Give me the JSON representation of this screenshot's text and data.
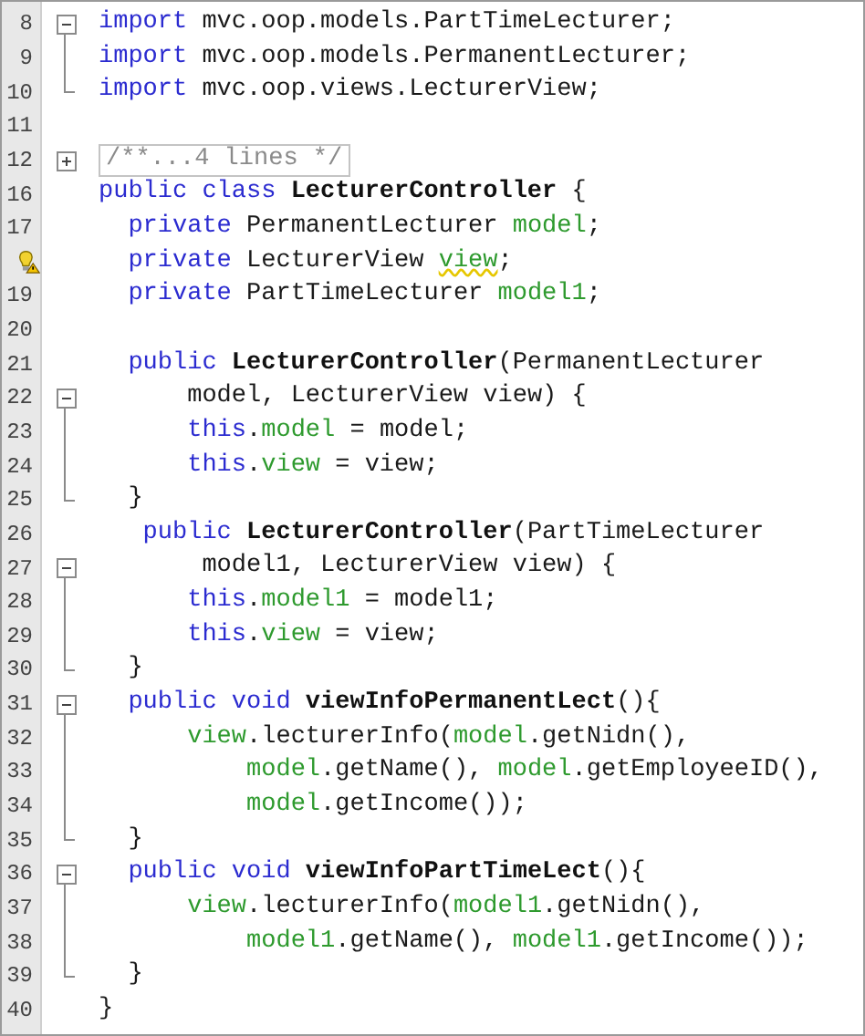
{
  "lines": [
    {
      "number": "8",
      "warning": false,
      "fold": {
        "kind": "start"
      },
      "tokens": [
        {
          "kind": "keyword",
          "text": "import"
        },
        {
          "kind": "plain",
          "text": " mvc.oop.models.PartTimeLecturer;"
        }
      ]
    },
    {
      "number": "9",
      "warning": false,
      "fold": {
        "kind": "line"
      },
      "tokens": [
        {
          "kind": "keyword",
          "text": "import"
        },
        {
          "kind": "plain",
          "text": " mvc.oop.models.PermanentLecturer;"
        }
      ]
    },
    {
      "number": "10",
      "warning": false,
      "fold": {
        "kind": "end"
      },
      "tokens": [
        {
          "kind": "keyword",
          "text": "import"
        },
        {
          "kind": "plain",
          "text": " mvc.oop.views.LecturerView;"
        }
      ]
    },
    {
      "number": "11",
      "warning": false
    },
    {
      "number": "12",
      "warning": false,
      "fold": {
        "kind": "collapsed"
      },
      "tokens": [
        {
          "kind": "folded",
          "text": "/**...4 lines */"
        }
      ]
    },
    {
      "number": "16",
      "warning": false,
      "tokens": [
        {
          "kind": "keyword",
          "text": "public class"
        },
        {
          "kind": "name",
          "text": "LecturerController"
        },
        {
          "kind": "plain",
          "text": " {"
        }
      ]
    },
    {
      "number": "17",
      "warning": false,
      "tokens": [
        {
          "kind": "keyword",
          "text": "  private"
        },
        {
          "kind": "plain",
          "text": " PermanentLecturer "
        },
        {
          "kind": "field",
          "text": "model"
        },
        {
          "kind": "plain",
          "text": ";"
        }
      ]
    },
    {
      "warning": true,
      "tokens": [
        {
          "kind": "keyword",
          "text": "  private"
        },
        {
          "kind": "plain",
          "text": " LecturerView "
        },
        {
          "kind": "field",
          "text": "view"
        },
        {
          "kind": "plain",
          "text": ";"
        }
      ]
    },
    {
      "number": "19",
      "warning": false,
      "tokens": [
        {
          "kind": "keyword",
          "text": "  private"
        },
        {
          "kind": "plain",
          "text": " PartTimeLecturer "
        },
        {
          "kind": "field",
          "text": "model1"
        },
        {
          "kind": "plain",
          "text": ";"
        }
      ]
    },
    {
      "number": "20",
      "warning": false
    },
    {
      "number": "21",
      "warning": false,
      "tokens": [
        {
          "kind": "keyword",
          "text": "  public"
        },
        {
          "kind": "name",
          "text": "LecturerController"
        },
        {
          "kind": "plain",
          "text": "(PermanentLecturer"
        }
      ]
    },
    {
      "number": "22",
      "warning": false,
      "fold": {
        "kind": "start"
      },
      "tokens": [
        {
          "kind": "plain",
          "text": "      model, LecturerView view) {"
        }
      ]
    },
    {
      "number": "23",
      "warning": false,
      "fold": {
        "kind": "line"
      },
      "tokens": [
        {
          "kind": "keyword",
          "text": "      this"
        },
        {
          "kind": "plain",
          "text": "."
        },
        {
          "kind": "field",
          "text": "model"
        },
        {
          "kind": "plain",
          "text": " = model;"
        }
      ]
    },
    {
      "number": "24",
      "warning": false,
      "fold": {
        "kind": "line"
      },
      "tokens": [
        {
          "kind": "keyword",
          "text": "      this"
        },
        {
          "kind": "plain",
          "text": "."
        },
        {
          "kind": "field",
          "text": "view"
        },
        {
          "kind": "plain",
          "text": " = view;"
        }
      ]
    },
    {
      "number": "25",
      "warning": false,
      "fold": {
        "kind": "end"
      },
      "tokens": [
        {
          "kind": "plain",
          "text": "  }"
        }
      ]
    },
    {
      "number": "26",
      "warning": false,
      "tokens": [
        {
          "kind": "keyword",
          "text": "   public"
        },
        {
          "kind": "name",
          "text": "LecturerController"
        },
        {
          "kind": "plain",
          "text": "(PartTimeLecturer"
        }
      ]
    },
    {
      "number": "27",
      "warning": false,
      "fold": {
        "kind": "start"
      },
      "tokens": [
        {
          "kind": "plain",
          "text": "       model1, LecturerView view) {"
        }
      ]
    },
    {
      "number": "28",
      "warning": false,
      "fold": {
        "kind": "line"
      },
      "tokens": [
        {
          "kind": "keyword",
          "text": "      this"
        },
        {
          "kind": "plain",
          "text": "."
        },
        {
          "kind": "field",
          "text": "model1"
        },
        {
          "kind": "plain",
          "text": " = model1;"
        }
      ]
    },
    {
      "number": "29",
      "warning": false,
      "fold": {
        "kind": "line"
      },
      "tokens": [
        {
          "kind": "keyword",
          "text": "      this"
        },
        {
          "kind": "plain",
          "text": "."
        },
        {
          "kind": "field",
          "text": "view"
        },
        {
          "kind": "plain",
          "text": " = view;"
        }
      ]
    },
    {
      "number": "30",
      "warning": false,
      "fold": {
        "kind": "end"
      },
      "tokens": [
        {
          "kind": "plain",
          "text": "  }"
        }
      ]
    },
    {
      "number": "31",
      "warning": false,
      "fold": {
        "kind": "start"
      },
      "tokens": [
        {
          "kind": "keyword",
          "text": "  public void"
        },
        {
          "kind": "name",
          "text": "viewInfoPermanentLect"
        },
        {
          "kind": "plain",
          "text": "(){"
        }
      ]
    },
    {
      "number": "32",
      "warning": false,
      "fold": {
        "kind": "line"
      },
      "tokens": [
        {
          "kind": "field",
          "text": "      view"
        },
        {
          "kind": "plain",
          "text": ".lecturerInfo("
        },
        {
          "kind": "field",
          "text": "model"
        },
        {
          "kind": "plain",
          "text": ".getNidn(),"
        }
      ]
    },
    {
      "number": "33",
      "warning": false,
      "fold": {
        "kind": "line"
      },
      "tokens": [
        {
          "kind": "field",
          "text": "          model"
        },
        {
          "kind": "plain",
          "text": ".getName(), "
        },
        {
          "kind": "field",
          "text": "model"
        },
        {
          "kind": "plain",
          "text": ".getEmployeeID(),"
        }
      ]
    },
    {
      "number": "34",
      "warning": false,
      "fold": {
        "kind": "line"
      },
      "tokens": [
        {
          "kind": "field",
          "text": "          model"
        },
        {
          "kind": "plain",
          "text": ".getIncome());"
        }
      ]
    },
    {
      "number": "35",
      "warning": false,
      "fold": {
        "kind": "end"
      },
      "tokens": [
        {
          "kind": "plain",
          "text": "  }"
        }
      ]
    },
    {
      "number": "36",
      "warning": false,
      "fold": {
        "kind": "start"
      },
      "tokens": [
        {
          "kind": "keyword",
          "text": "  public void"
        },
        {
          "kind": "name",
          "text": "viewInfoPartTimeLect"
        },
        {
          "kind": "plain",
          "text": "(){"
        }
      ]
    },
    {
      "number": "37",
      "warning": false,
      "fold": {
        "kind": "line"
      },
      "tokens": [
        {
          "kind": "field",
          "text": "      view"
        },
        {
          "kind": "plain",
          "text": ".lecturerInfo("
        },
        {
          "kind": "field",
          "text": "model1"
        },
        {
          "kind": "plain",
          "text": ".getNidn(),"
        }
      ]
    },
    {
      "number": "38",
      "warning": false,
      "fold": {
        "kind": "line"
      },
      "tokens": [
        {
          "kind": "field",
          "text": "          model1"
        },
        {
          "kind": "plain",
          "text": ".getName(), "
        },
        {
          "kind": "field",
          "text": "model1"
        },
        {
          "kind": "plain",
          "text": ".getIncome());"
        }
      ]
    },
    {
      "number": "39",
      "warning": false,
      "fold": {
        "kind": "end"
      },
      "tokens": [
        {
          "kind": "plain",
          "text": "  }"
        }
      ]
    },
    {
      "number": "40",
      "warning": false,
      "tokens": [
        {
          "kind": "plain",
          "text": "}"
        }
      ]
    }
  ]
}
